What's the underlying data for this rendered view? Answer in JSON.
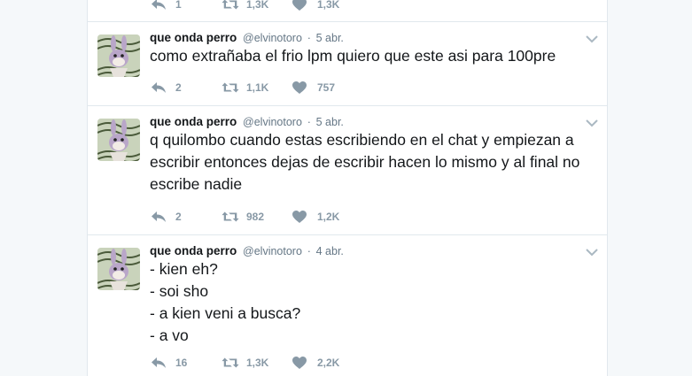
{
  "tweets": [
    {
      "partial": true,
      "replies": "1",
      "retweets": "1,3K",
      "likes": "1,3K"
    },
    {
      "name": "que onda perro",
      "handle": "@elvinotoro",
      "sep": "·",
      "time": "5 abr.",
      "lines": [
        "como extrañaba el frio lpm quiero que este asi para 100pre"
      ],
      "replies": "2",
      "retweets": "1,1K",
      "likes": "757"
    },
    {
      "name": "que onda perro",
      "handle": "@elvinotoro",
      "sep": "·",
      "time": "5 abr.",
      "lines": [
        "q quilombo cuando estas escribiendo en el chat y empiezan a",
        "escribir entonces dejas de escribir hacen lo mismo y al final no",
        "escribe nadie"
      ],
      "replies": "2",
      "retweets": "982",
      "likes": "1,2K"
    },
    {
      "name": "que onda perro",
      "handle": "@elvinotoro",
      "sep": "·",
      "time": "4 abr.",
      "lines": [
        "- kien eh?",
        "- soi sho",
        "- a kien veni a busca?",
        "- a vo"
      ],
      "replies": "16",
      "retweets": "1,3K",
      "likes": "2,2K"
    }
  ],
  "icons": {
    "reply": "reply-icon",
    "retweet": "retweet-icon",
    "like": "heart-icon",
    "caret": "chevron-down-icon"
  },
  "colors": {
    "background": "#f5f8fa",
    "card": "#ffffff",
    "border": "#e1e8ed",
    "muted": "#657786",
    "actions": "#8899a6"
  }
}
